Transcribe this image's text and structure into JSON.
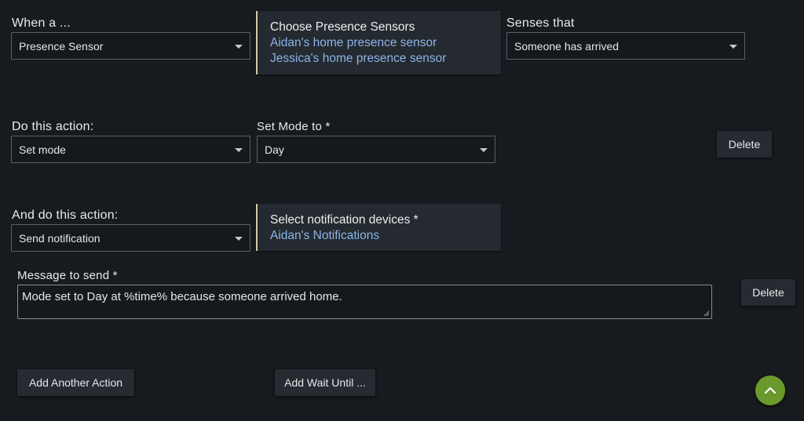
{
  "trigger": {
    "when_label": "When a ...",
    "device_type_value": "Presence Sensor",
    "picker_title": "Choose Presence Sensors",
    "picker_items": [
      "Aidan's home presence sensor",
      "Jessica's home presence sensor"
    ],
    "senses_label": "Senses that",
    "senses_value": "Someone has arrived"
  },
  "action1": {
    "label": "Do this action:",
    "action_value": "Set mode",
    "mode_label": "Set Mode to *",
    "mode_value": "Day",
    "delete_label": "Delete"
  },
  "action2": {
    "label": "And do this action:",
    "action_value": "Send notification",
    "picker_title": "Select notification devices *",
    "picker_items": [
      "Aidan's Notifications"
    ],
    "message_label": "Message to send *",
    "message_value": "Mode set to Day at %time% because someone arrived home.",
    "delete_label": "Delete"
  },
  "footer": {
    "add_action_label": "Add Another Action",
    "add_wait_label": "Add Wait Until ..."
  },
  "colors": {
    "background": "#171a1e",
    "link": "#8db4e8",
    "fab": "#6a9a2c"
  },
  "icons": {
    "fab": "chevron-up-icon",
    "dropdown": "caret-down-icon",
    "resize": "resize-grip-icon"
  }
}
